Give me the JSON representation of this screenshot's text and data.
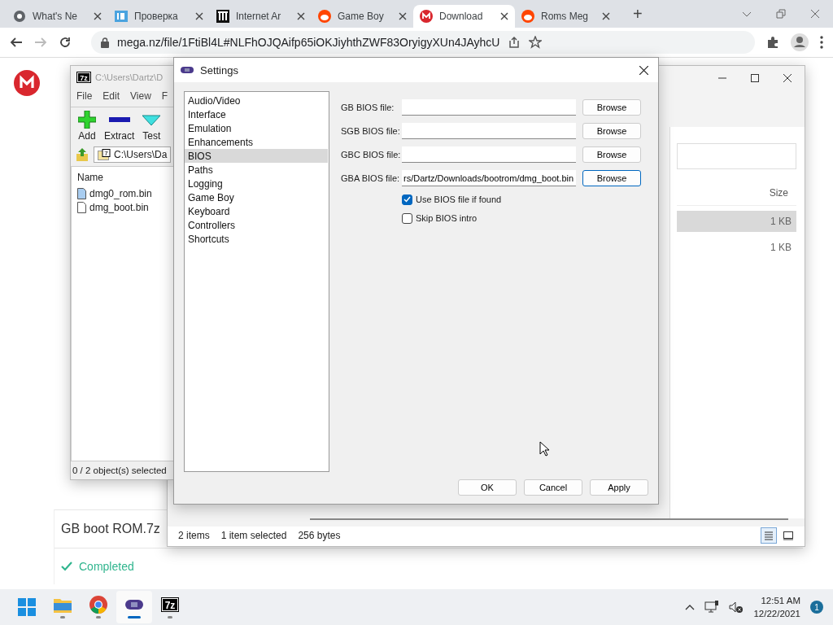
{
  "browser": {
    "tabs": [
      {
        "title": "What's Ne",
        "kind": "chrome",
        "selected": false
      },
      {
        "title": "Проверка",
        "kind": "ip",
        "selected": false
      },
      {
        "title": "Internet Ar",
        "kind": "archive",
        "selected": false
      },
      {
        "title": "Game Boy",
        "kind": "reddit",
        "selected": false
      },
      {
        "title": "Download",
        "kind": "mega",
        "selected": true
      },
      {
        "title": "Roms Meg",
        "kind": "reddit",
        "selected": false
      }
    ],
    "new_tab": "+",
    "address": "mega.nz/file/1FtiBl4L#NLFhOJQAifp65iOKJiyhthZWF83OryigyXUn4JAyhcU"
  },
  "mega_page": {
    "file_name": "GB boot ROM.7z",
    "status": "Completed"
  },
  "explorer": {
    "column_header": "Size",
    "rows": [
      {
        "size": "1 KB",
        "selected": true
      },
      {
        "size": "1 KB",
        "selected": false
      }
    ],
    "status_bar": {
      "items": "2 items",
      "selection": "1 item selected",
      "size": "256 bytes"
    },
    "views": [
      {
        "kind": "details",
        "selected": true
      },
      {
        "kind": "tiles",
        "selected": false
      }
    ]
  },
  "sevenzip": {
    "logo": "7z",
    "title": "C:\\Users\\Dartz\\D",
    "menu": [
      "File",
      "Edit",
      "View",
      "F"
    ],
    "toolbar": [
      {
        "label": "Add",
        "kind": "add"
      },
      {
        "label": "Extract",
        "kind": "extract"
      },
      {
        "label": "Test",
        "kind": "test"
      }
    ],
    "path_logo": "7",
    "path": "C:\\Users\\Da",
    "column": "Name",
    "files": [
      {
        "name": "dmg0_rom.bin",
        "kind": "rom"
      },
      {
        "name": "dmg_boot.bin",
        "kind": "plain"
      }
    ],
    "status": "0 / 2 object(s) selected"
  },
  "settings": {
    "title": "Settings",
    "categories": [
      {
        "label": "Audio/Video",
        "selected": false
      },
      {
        "label": "Interface",
        "selected": false
      },
      {
        "label": "Emulation",
        "selected": false
      },
      {
        "label": "Enhancements",
        "selected": false
      },
      {
        "label": "BIOS",
        "selected": true
      },
      {
        "label": "Paths",
        "selected": false
      },
      {
        "label": "Logging",
        "selected": false
      },
      {
        "label": "Game Boy",
        "selected": false
      },
      {
        "label": "Keyboard",
        "selected": false
      },
      {
        "label": "Controllers",
        "selected": false
      },
      {
        "label": "Shortcuts",
        "selected": false
      }
    ],
    "bios_fields": [
      {
        "label": "GB BIOS file:",
        "button": "Browse",
        "focused": false
      },
      {
        "label": "SGB BIOS file:",
        "button": "Browse",
        "focused": false
      },
      {
        "label": "GBC BIOS file:",
        "button": "Browse",
        "focused": false
      },
      {
        "label": "GBA BIOS file:",
        "value": "rs/Dartz/Downloads/bootrom/dmg_boot.bin",
        "button": "Browse",
        "focused": true
      }
    ],
    "checkboxes": [
      {
        "label": "Use BIOS file if found",
        "checked": true
      },
      {
        "label": "Skip BIOS intro",
        "checked": false
      }
    ],
    "buttons": [
      "OK",
      "Cancel",
      "Apply"
    ]
  },
  "taskbar": {
    "apps": [
      {
        "kind": "start",
        "running": false,
        "active": false
      },
      {
        "kind": "folder",
        "running": true,
        "active": false
      },
      {
        "kind": "chrome",
        "running": true,
        "active": false
      },
      {
        "kind": "gba",
        "running": true,
        "active": true
      },
      {
        "kind": "sevenzip",
        "label": "7z",
        "running": true,
        "active": false
      }
    ],
    "time": "12:51 AM",
    "date": "12/22/2021",
    "badge": "1"
  }
}
